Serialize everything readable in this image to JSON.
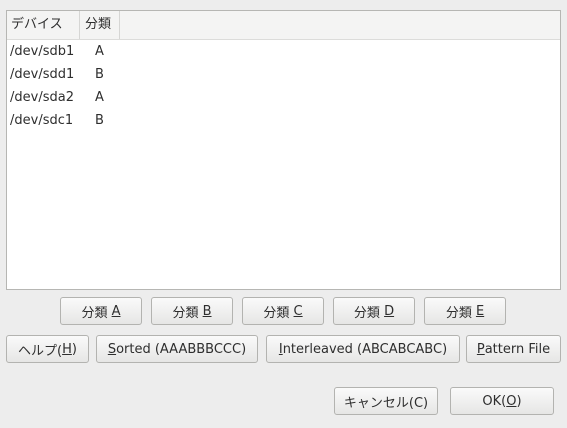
{
  "list": {
    "columns": {
      "device": "デバイス",
      "class": "分類"
    },
    "rows": [
      {
        "device": "/dev/sdb1",
        "class": "A"
      },
      {
        "device": "/dev/sdd1",
        "class": "B"
      },
      {
        "device": "/dev/sda2",
        "class": "A"
      },
      {
        "device": "/dev/sdc1",
        "class": "B"
      }
    ]
  },
  "class_buttons": {
    "a": {
      "label": "分類 ",
      "mnemonic": "A"
    },
    "b": {
      "label": "分類 ",
      "mnemonic": "B"
    },
    "c": {
      "label": "分類 ",
      "mnemonic": "C"
    },
    "d": {
      "label": "分類 ",
      "mnemonic": "D"
    },
    "e": {
      "label": "分類 ",
      "mnemonic": "E"
    }
  },
  "action_buttons": {
    "help": {
      "pre": "ヘルプ(",
      "mnemonic": "H",
      "post": ")"
    },
    "sorted": {
      "mnemonic": "S",
      "post": "orted (AAABBBCCC)"
    },
    "interleaved": {
      "mnemonic": "I",
      "post": "nterleaved (ABCABCABC)"
    },
    "pattern": {
      "mnemonic": "P",
      "post": "attern File"
    }
  },
  "dialog_buttons": {
    "cancel": {
      "label": "キャンセル(C)"
    },
    "ok": {
      "pre": "OK(",
      "mnemonic": "O",
      "post": ")"
    }
  }
}
